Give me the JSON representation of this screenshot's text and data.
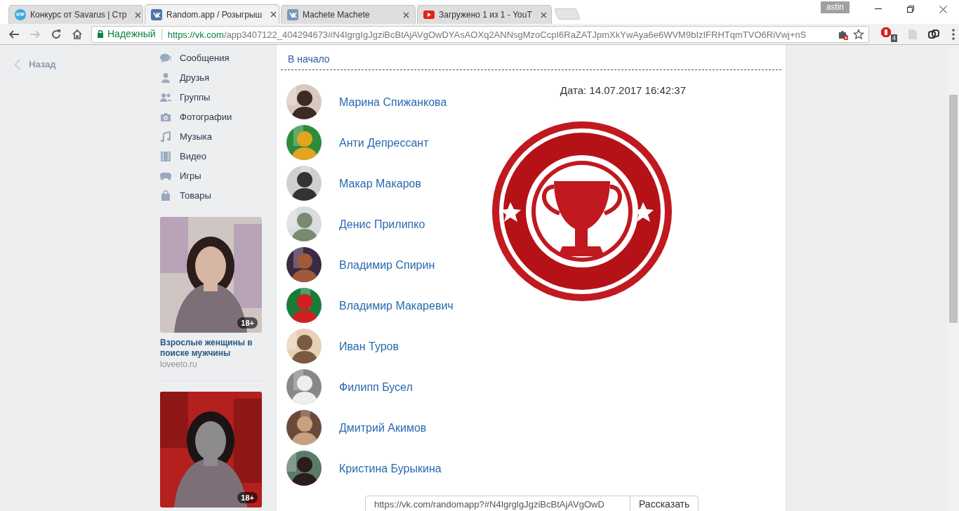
{
  "browser": {
    "tabs": [
      {
        "title": "Конкурс от Savarus | Стр",
        "kind": "label",
        "icon_label": "КФ",
        "selected": false
      },
      {
        "title": "Random.app / Розыгрыш",
        "kind": "vk",
        "selected": true
      },
      {
        "title": "Machete Machete",
        "kind": "vk",
        "selected": false
      },
      {
        "title": "Загружено 1 из 1 - YouT",
        "kind": "youtube",
        "selected": false
      }
    ],
    "profile": "astin",
    "nav": [
      {
        "kind": "back",
        "disabled": false
      },
      {
        "kind": "forward",
        "disabled": true
      },
      {
        "kind": "reload",
        "disabled": false
      },
      {
        "kind": "home",
        "disabled": false
      }
    ],
    "address": {
      "secure_label": "Надежный",
      "host": "https://vk.com",
      "path": "/app3407122_404294673#N4IgrgIgJgziBcBtAjAVgOwDYAsAOXq2ANNsgMzoCcpI6RaZATJpmXkYwAya6e6WVM9bIzIFRHTqmTVO6RiVwj+nS"
    },
    "extensions": [
      {
        "kind": "stop",
        "badge": "4"
      },
      {
        "kind": "file"
      },
      {
        "kind": "link"
      }
    ]
  },
  "sidebar": {
    "back": "Назад",
    "items": [
      {
        "label": "Сообщения",
        "kind": "messages"
      },
      {
        "label": "Друзья",
        "kind": "friends"
      },
      {
        "label": "Группы",
        "kind": "groups"
      },
      {
        "label": "Фотографии",
        "kind": "photos"
      },
      {
        "label": "Музыка",
        "kind": "music"
      },
      {
        "label": "Видео",
        "kind": "video"
      },
      {
        "label": "Игры",
        "kind": "games"
      },
      {
        "label": "Товары",
        "kind": "goods"
      }
    ],
    "ads": [
      {
        "title": "Взрослые женщины в поиске мужчины",
        "domain": "loveeto.ru",
        "badge": "18+"
      },
      {
        "badge": "18+"
      }
    ]
  },
  "main": {
    "home_link": "В начало",
    "date": "Дата: 14.07.2017 16:42:37",
    "winners": [
      {
        "name": "Марина Спижанкова"
      },
      {
        "name": "Анти Депрессант"
      },
      {
        "name": "Макар Макаров"
      },
      {
        "name": "Денис Прилипко"
      },
      {
        "name": "Владимир Спирин"
      },
      {
        "name": "Владимир Макаревич"
      },
      {
        "name": "Иван Туров"
      },
      {
        "name": "Филипп Бусел"
      },
      {
        "name": "Дмитрий Акимов"
      },
      {
        "name": "Кристина Бурыкина"
      }
    ],
    "share": {
      "value": "https://vk.com/randomapp?#N4IgrglgJgziBcBtAjAVgOwD",
      "button": "Рассказать"
    }
  }
}
